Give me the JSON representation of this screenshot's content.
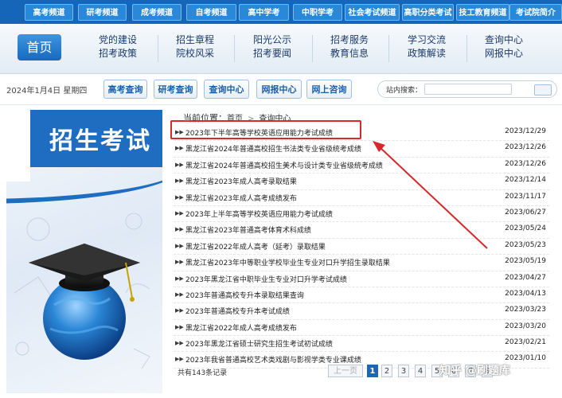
{
  "topnav": {
    "tabs": [
      "高考频道",
      "研考频道",
      "成考频道",
      "自考频道",
      "高中学考",
      "中职学考",
      "社会考试频道",
      "高职分类考试",
      "技工教育频道",
      "考试院简介"
    ]
  },
  "mainnav": {
    "home": "首页",
    "cells": [
      {
        "l1": "党的建设",
        "l2": "招考政策"
      },
      {
        "l1": "招生章程",
        "l2": "院校风采"
      },
      {
        "l1": "阳光公示",
        "l2": "招考要闻"
      },
      {
        "l1": "招考服务",
        "l2": "教育信息"
      },
      {
        "l1": "学习交流",
        "l2": "政策解读"
      },
      {
        "l1": "查询中心",
        "l2": "网报中心"
      }
    ]
  },
  "toolbar": {
    "date": "2024年1月4日   星期四",
    "buttons": [
      "高考查询",
      "研考查询",
      "查询中心",
      "网报中心",
      "网上咨询"
    ],
    "search_label": "站内搜索：",
    "search_value": ""
  },
  "banner": {
    "title": "招生考试"
  },
  "breadcrumb": {
    "prefix": "当前位置：",
    "home": "首页",
    "current": "查询中心"
  },
  "list": [
    {
      "title": "2023年下半年高等学校英语应用能力考试成绩",
      "date": "2023/12/29"
    },
    {
      "title": "黑龙江省2024年普通高校招生书法类专业省级统考成绩",
      "date": "2023/12/26"
    },
    {
      "title": "黑龙江省2024年普通高校招生美术与设计类专业省级统考成绩",
      "date": "2023/12/26"
    },
    {
      "title": "黑龙江省2023年成人高考录取结果",
      "date": "2023/12/14"
    },
    {
      "title": "黑龙江省2023年成人高考成绩发布",
      "date": "2023/11/17"
    },
    {
      "title": "2023年上半年高等学校英语应用能力考试成绩",
      "date": "2023/06/27"
    },
    {
      "title": "黑龙江省2023年普通高考体育术科成绩",
      "date": "2023/05/24"
    },
    {
      "title": "黑龙江省2022年成人高考（延考）录取结果",
      "date": "2023/05/23"
    },
    {
      "title": "黑龙江省2023年中等职业学校毕业生专业对口升学招生录取结果",
      "date": "2023/05/19"
    },
    {
      "title": "2023年黑龙江省中职毕业生专业对口升学考试成绩",
      "date": "2023/04/27"
    },
    {
      "title": "2023年普通高校专升本录取结果查询",
      "date": "2023/04/13"
    },
    {
      "title": "2023年普通高校专升本考试成绩",
      "date": "2023/03/23"
    },
    {
      "title": "黑龙江省2022年成人高考成绩发布",
      "date": "2023/03/20"
    },
    {
      "title": "2023年黑龙江省硕士研究生招生考试初试成绩",
      "date": "2023/02/21"
    },
    {
      "title": "2023年我省普通高校艺术类戏剧与影视学类专业课成绩",
      "date": "2023/01/10"
    }
  ],
  "pager": {
    "count": "共有143条记录",
    "prev": "上一页",
    "pages": [
      "1",
      "2",
      "3",
      "4",
      "5",
      "6",
      "7",
      "8"
    ],
    "current": "1"
  },
  "watermark": "知乎 @刷题库",
  "colors": {
    "nav_blue": "#1565b8",
    "highlight_red": "#d8282c",
    "pager_active": "#1a66b8"
  }
}
